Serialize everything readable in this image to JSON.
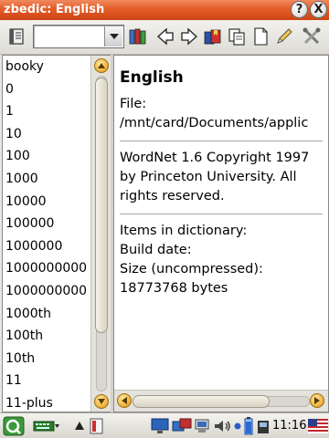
{
  "window": {
    "title": "zbedic: English",
    "help_label": "?",
    "close_label": "X"
  },
  "toolbar": {
    "search_value": "",
    "icons": [
      "dictionary-icon",
      "dropdown-icon",
      "books-icon",
      "back-arrow-icon",
      "forward-arrow-icon",
      "bookmarks-icon",
      "copy-icon",
      "new-document-icon",
      "edit-icon",
      "tools-icon"
    ]
  },
  "word_list": {
    "items": [
      "booky",
      "0",
      "1",
      "10",
      "100",
      "1000",
      "10000",
      "100000",
      "1000000",
      "1000000000",
      "1000000000",
      "1000th",
      "100th",
      "10th",
      "11",
      "11-plus"
    ]
  },
  "info": {
    "heading": "English",
    "file_label": "File:",
    "file_path": "/mnt/card/Documents/applic",
    "copyright_lines": [
      "WordNet 1.6 Copyright 1997",
      "by Princeton University. All",
      "rights reserved."
    ],
    "items_label": "Items in dictionary:",
    "build_label": "Build date:",
    "size_label": "Size (uncompressed):",
    "size_value": "18773768 bytes"
  },
  "taskbar": {
    "time": "11:16",
    "icons": [
      "opie-start-icon",
      "keyboard-icon",
      "up-arrow-icon",
      "app-icon",
      "monitor-icon",
      "network-icon",
      "audio-icon",
      "status-dot-icon",
      "battery-icon",
      "wireless-icon",
      "flag-icon"
    ]
  },
  "colors": {
    "titlebar_accent": "#e45c28",
    "scroll_arrow": "#f0b640"
  }
}
